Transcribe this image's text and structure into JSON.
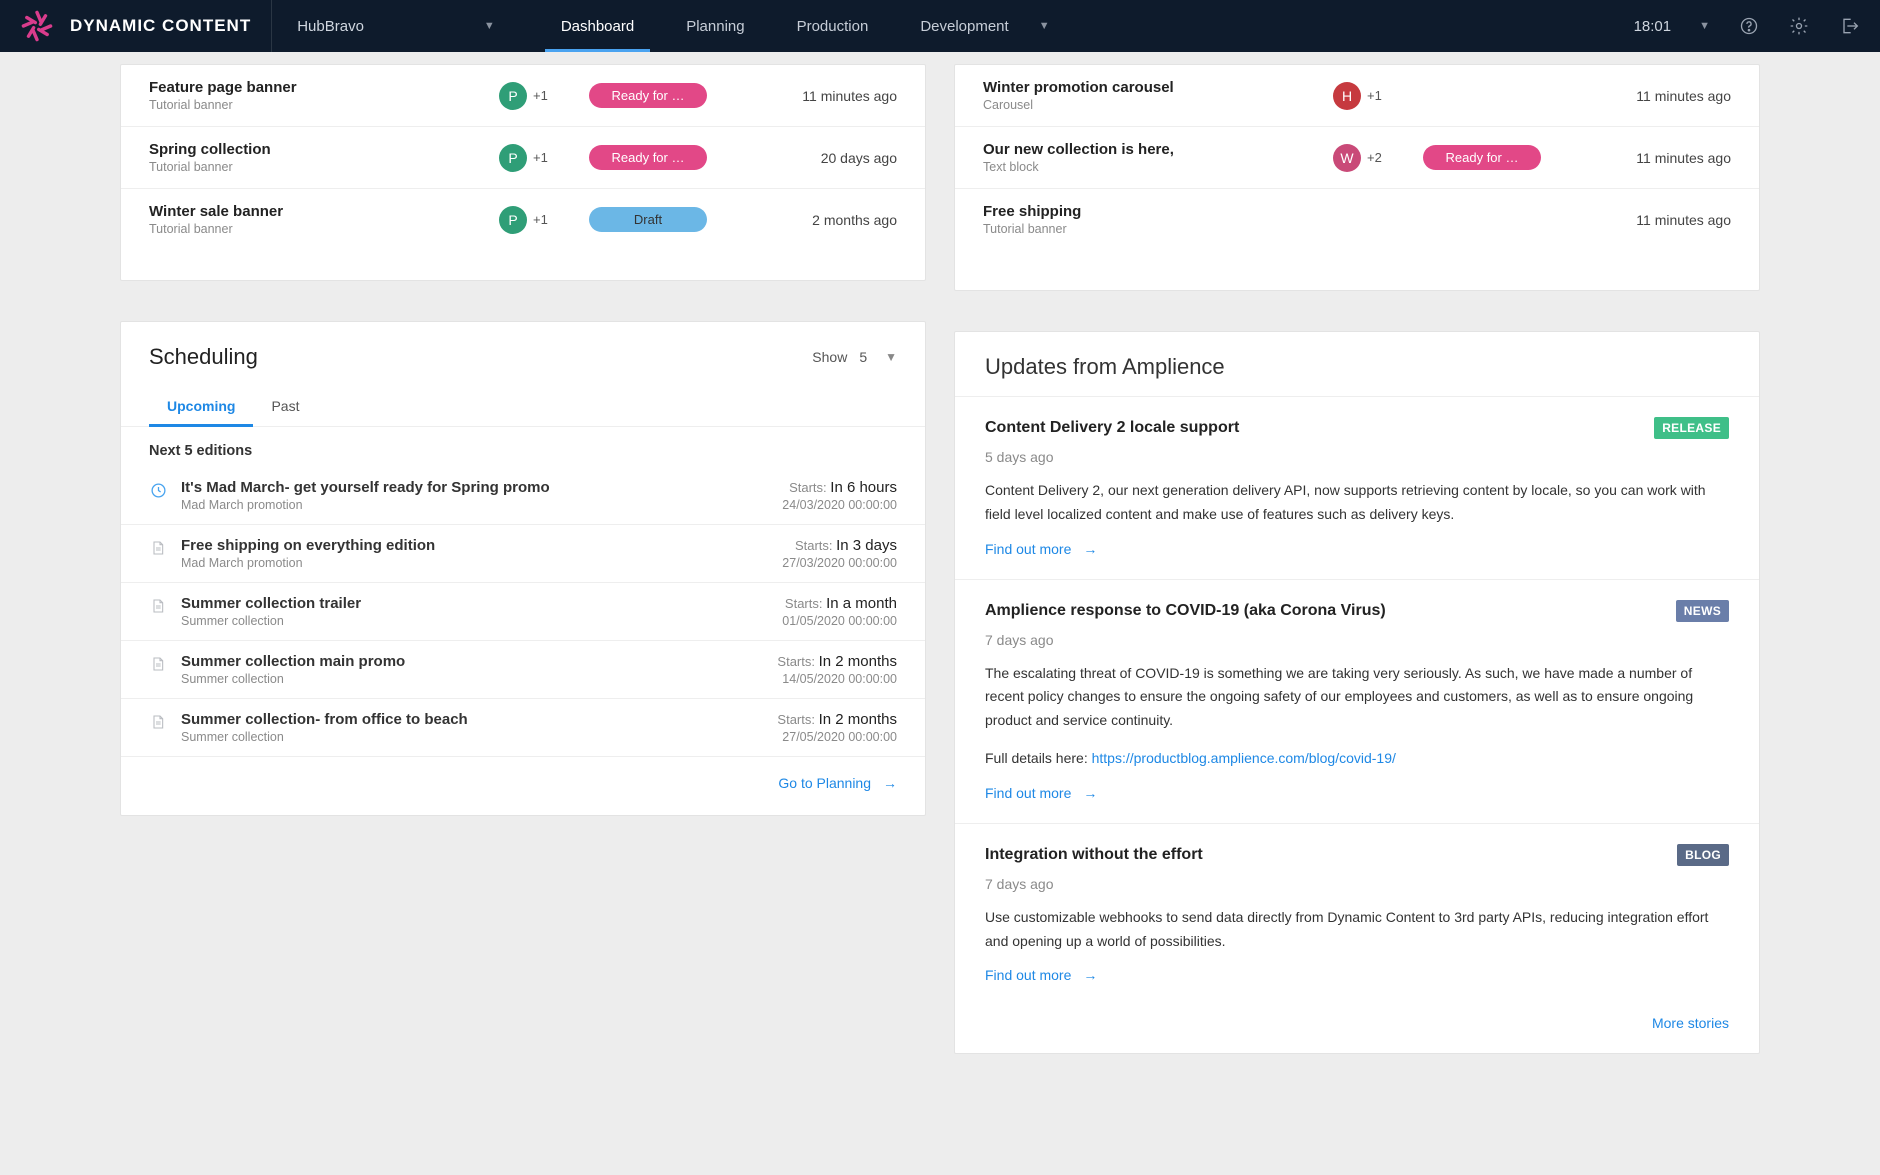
{
  "topbar": {
    "app_name": "DYNAMIC CONTENT",
    "hub_name": "HubBravo",
    "nav": [
      {
        "label": "Dashboard",
        "active": true,
        "caret": false
      },
      {
        "label": "Planning",
        "active": false,
        "caret": false
      },
      {
        "label": "Production",
        "active": false,
        "caret": false
      },
      {
        "label": "Development",
        "active": false,
        "caret": true
      }
    ],
    "clock": "18:01"
  },
  "left_content": {
    "items": [
      {
        "title": "Feature page banner",
        "subtitle": "Tutorial banner",
        "avatar": {
          "letter": "P",
          "color": "green"
        },
        "plus": "+1",
        "status": {
          "label": "Ready for …",
          "style": "pink"
        },
        "time": "11 minutes ago"
      },
      {
        "title": "Spring collection",
        "subtitle": "Tutorial banner",
        "avatar": {
          "letter": "P",
          "color": "green"
        },
        "plus": "+1",
        "status": {
          "label": "Ready for …",
          "style": "pink"
        },
        "time": "20 days ago"
      },
      {
        "title": "Winter sale banner",
        "subtitle": "Tutorial banner",
        "avatar": {
          "letter": "P",
          "color": "green"
        },
        "plus": "+1",
        "status": {
          "label": "Draft",
          "style": "blue"
        },
        "time": "2 months ago"
      }
    ]
  },
  "right_content": {
    "items": [
      {
        "title": "Winter promotion carousel",
        "subtitle": "Carousel",
        "avatar": {
          "letter": "H",
          "color": "red"
        },
        "plus": "+1",
        "status": null,
        "time": "11 minutes ago"
      },
      {
        "title": "Our new collection is here,",
        "subtitle": "Text block",
        "avatar": {
          "letter": "W",
          "color": "pink"
        },
        "plus": "+2",
        "status": {
          "label": "Ready for …",
          "style": "pink"
        },
        "time": "11 minutes ago"
      },
      {
        "title": "Free shipping",
        "subtitle": "Tutorial banner",
        "avatar": null,
        "plus": null,
        "status": null,
        "time": "11 minutes ago"
      }
    ]
  },
  "scheduling": {
    "title": "Scheduling",
    "show_label": "Show",
    "show_value": "5",
    "tabs": [
      {
        "label": "Upcoming",
        "active": true
      },
      {
        "label": "Past",
        "active": false
      }
    ],
    "subhead": "Next 5 editions",
    "starts_label": "Starts:",
    "editions": [
      {
        "icon": "clock",
        "title": "It's Mad March- get yourself ready for Spring promo",
        "subtitle": "Mad March promotion",
        "when": "In 6 hours",
        "date": "24/03/2020 00:00:00"
      },
      {
        "icon": "doc",
        "title": "Free shipping on everything edition",
        "subtitle": "Mad March promotion",
        "when": "In 3 days",
        "date": "27/03/2020 00:00:00"
      },
      {
        "icon": "doc",
        "title": "Summer collection trailer",
        "subtitle": "Summer collection",
        "when": "In a month",
        "date": "01/05/2020 00:00:00"
      },
      {
        "icon": "doc",
        "title": "Summer collection main promo",
        "subtitle": "Summer collection",
        "when": "In 2 months",
        "date": "14/05/2020 00:00:00"
      },
      {
        "icon": "doc",
        "title": "Summer collection- from office to beach",
        "subtitle": "Summer collection",
        "when": "In 2 months",
        "date": "27/05/2020 00:00:00"
      }
    ],
    "footer_link": "Go to Planning"
  },
  "updates": {
    "title": "Updates from Amplience",
    "find_out_more": "Find out more",
    "more_stories": "More stories",
    "items": [
      {
        "badge": {
          "label": "RELEASE",
          "style": "release"
        },
        "title": "Content Delivery 2 locale support",
        "age": "5 days ago",
        "body": "Content Delivery 2, our next generation delivery API, now supports retrieving content by locale, so you can work with field level localized content and make use of features such as delivery keys.",
        "link_url": null,
        "link_prefix": null
      },
      {
        "badge": {
          "label": "NEWS",
          "style": "news"
        },
        "title": "Amplience response to COVID-19 (aka Corona Virus)",
        "age": "7 days ago",
        "body": "The escalating threat of COVID-19 is something we are taking very seriously. As such, we have made a number of recent policy changes to ensure the ongoing safety of our employees and customers, as well as to ensure ongoing product and service continuity.",
        "link_prefix": "Full details here: ",
        "link_url": "https://productblog.amplience.com/blog/covid-19/"
      },
      {
        "badge": {
          "label": "BLOG",
          "style": "blog"
        },
        "title": "Integration without the effort",
        "age": "7 days ago",
        "body": "Use customizable webhooks to send data directly from Dynamic Content to 3rd party APIs, reducing integration effort and opening up a world of possibilities.",
        "link_url": null,
        "link_prefix": null
      }
    ]
  }
}
